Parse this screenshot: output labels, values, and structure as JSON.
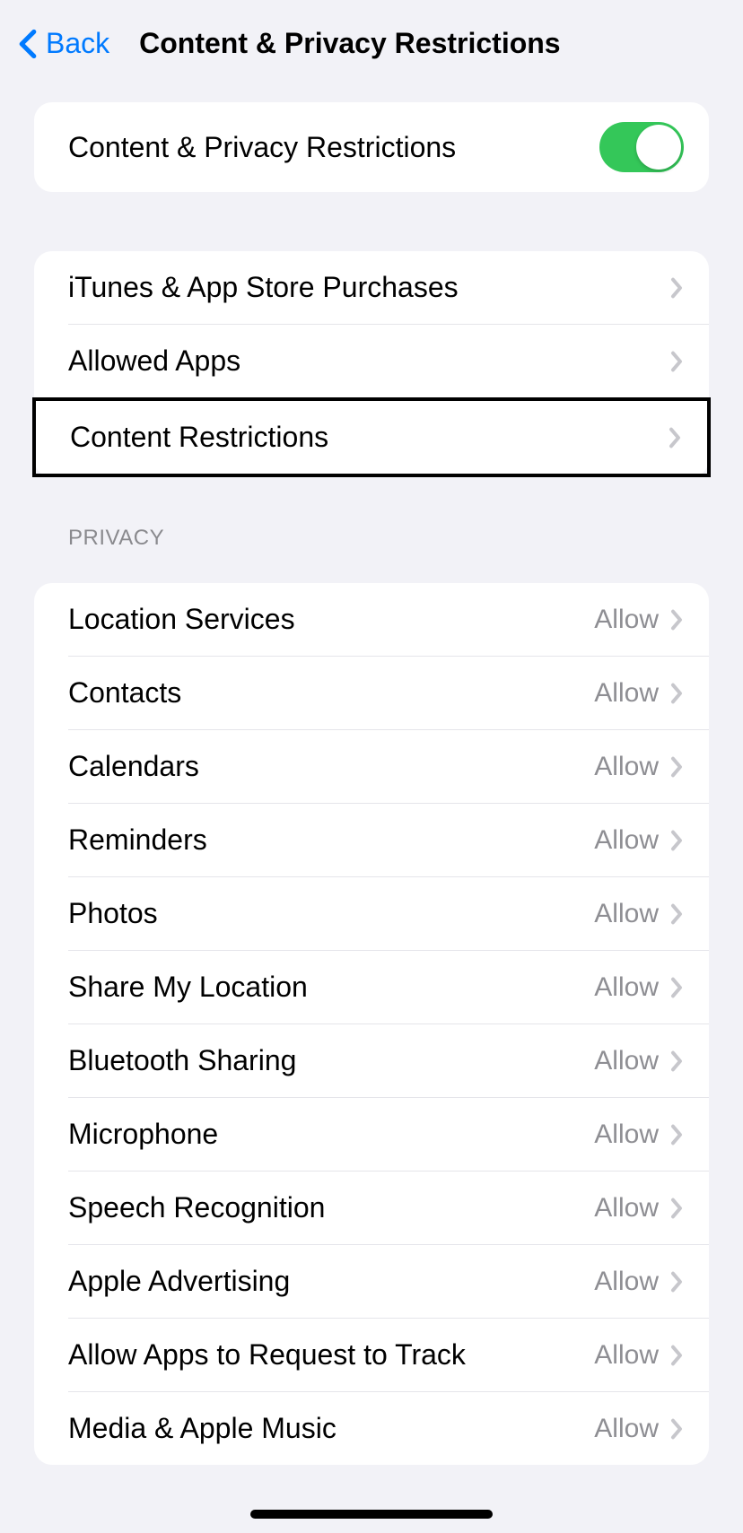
{
  "nav": {
    "back": "Back",
    "title": "Content & Privacy Restrictions"
  },
  "toggle_row": {
    "label": "Content & Privacy Restrictions",
    "enabled": true
  },
  "nav_section": {
    "items": [
      {
        "label": "iTunes & App Store Purchases"
      },
      {
        "label": "Allowed Apps"
      },
      {
        "label": "Content Restrictions"
      }
    ]
  },
  "privacy_section": {
    "header": "Privacy",
    "items": [
      {
        "label": "Location Services",
        "detail": "Allow"
      },
      {
        "label": "Contacts",
        "detail": "Allow"
      },
      {
        "label": "Calendars",
        "detail": "Allow"
      },
      {
        "label": "Reminders",
        "detail": "Allow"
      },
      {
        "label": "Photos",
        "detail": "Allow"
      },
      {
        "label": "Share My Location",
        "detail": "Allow"
      },
      {
        "label": "Bluetooth Sharing",
        "detail": "Allow"
      },
      {
        "label": "Microphone",
        "detail": "Allow"
      },
      {
        "label": "Speech Recognition",
        "detail": "Allow"
      },
      {
        "label": "Apple Advertising",
        "detail": "Allow"
      },
      {
        "label": "Allow Apps to Request to Track",
        "detail": "Allow"
      },
      {
        "label": "Media & Apple Music",
        "detail": "Allow"
      }
    ]
  }
}
